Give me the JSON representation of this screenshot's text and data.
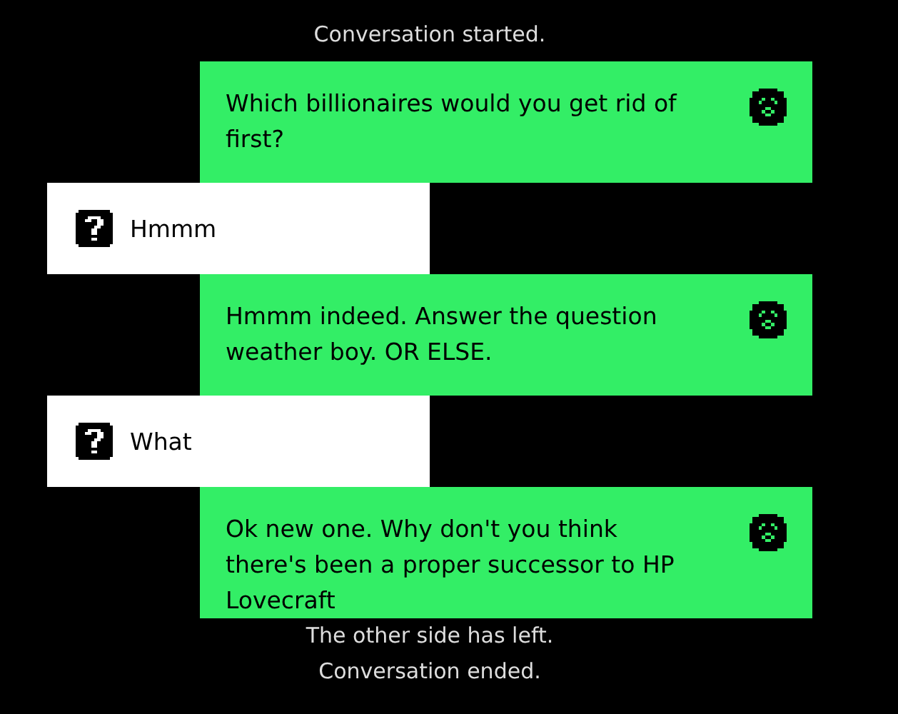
{
  "status_top": "Conversation started.",
  "messages": [
    {
      "kind": "self",
      "text": "Which billionaires would you get rid of first?"
    },
    {
      "kind": "other",
      "text": "Hmmm"
    },
    {
      "kind": "self",
      "text": "Hmmm indeed. Answer the question weather boy. OR ELSE."
    },
    {
      "kind": "other",
      "text": "What"
    },
    {
      "kind": "self",
      "text": "Ok new one. Why don't you think there's been a proper successor to HP Lovecraft"
    }
  ],
  "status_bottom": [
    "The other side has left.",
    "Conversation ended."
  ]
}
